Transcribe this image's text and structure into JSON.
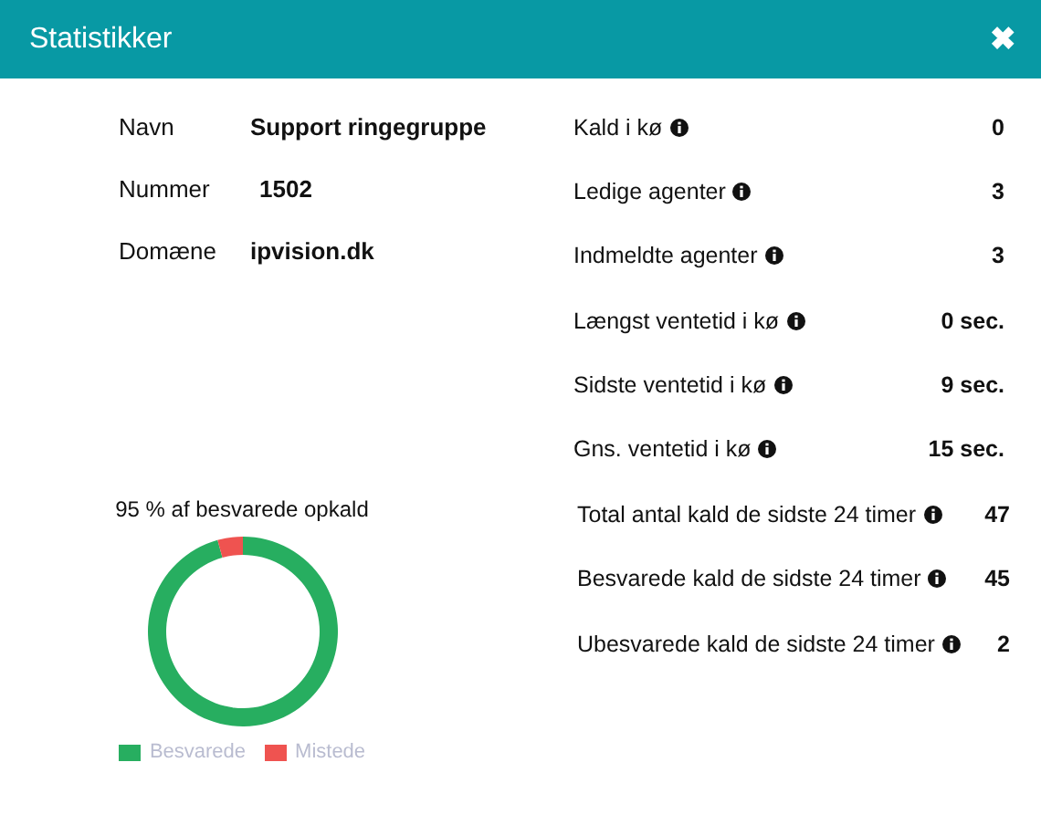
{
  "window": {
    "title": "Statistikker",
    "close": "✖"
  },
  "info": [
    {
      "label": "Navn",
      "value": "Support ringegruppe"
    },
    {
      "label": "Nummer",
      "value": "1502"
    },
    {
      "label": "Domæne",
      "value": "ipvision.dk"
    }
  ],
  "queue_stats": [
    {
      "label": "Kald i kø",
      "value": "0"
    },
    {
      "label": "Ledige agenter",
      "value": "3"
    },
    {
      "label": "Indmeldte agenter",
      "value": "3"
    },
    {
      "label": "Længst ventetid i kø",
      "value": "0 sec."
    },
    {
      "label": "Sidste ventetid i kø",
      "value": "9 sec."
    },
    {
      "label": "Gns. ventetid i kø",
      "value": "15 sec."
    }
  ],
  "daily_stats": [
    {
      "label": "Total antal kald de sidste 24 timer",
      "value": "47"
    },
    {
      "label": "Besvarede kald de sidste 24 timer",
      "value": "45"
    },
    {
      "label": "Ubesvarede kald de sidste 24 timer",
      "value": "2"
    }
  ],
  "chart_data": {
    "type": "donut",
    "title": "95 % af besvarede opkald",
    "categories": [
      "Besvarede",
      "Mistede"
    ],
    "values": [
      95.7,
      4.3
    ],
    "colors": [
      "#27ae60",
      "#ef5350"
    ]
  }
}
